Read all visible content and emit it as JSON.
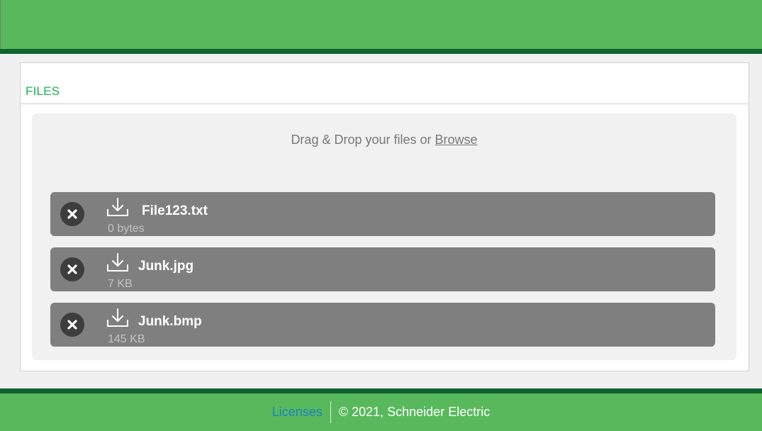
{
  "panel": {
    "title": "FILES"
  },
  "dropzone": {
    "prompt": "Drag & Drop your files or",
    "browse_label": "Browse"
  },
  "files": [
    {
      "name": "File123.txt",
      "size": "0 bytes"
    },
    {
      "name": "Junk.jpg",
      "size": "7 KB"
    },
    {
      "name": "Junk.bmp",
      "size": "145 KB"
    }
  ],
  "footer": {
    "licenses_label": "Licenses",
    "copyright": "© 2021, Schneider Electric"
  },
  "colors": {
    "header_green": "#58b95c",
    "dark_green": "#0e6231",
    "title_green": "#17b34f",
    "link_blue": "#1c7fc4",
    "file_row_gray": "#7f7f7f"
  },
  "icons": {
    "remove": "close-circle-icon",
    "download": "download-icon"
  }
}
